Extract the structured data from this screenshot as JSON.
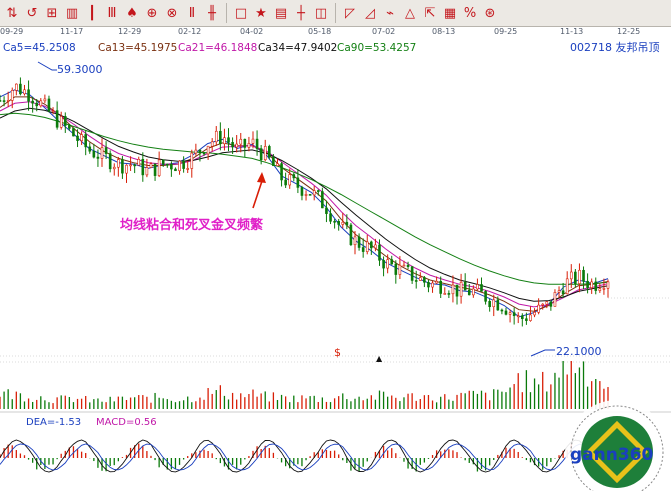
{
  "toolbar": {
    "icons": [
      "quote-icon",
      "reload-icon",
      "chart-icon",
      "grid-icon",
      "candle-icon",
      "bar-icon",
      "crosshair-icon",
      "target-icon",
      "zoom-icon",
      "line-icon",
      "bar-up-icon",
      "box-icon",
      "fan-icon",
      "draw-icon",
      "book-icon",
      "scale-icon",
      "fan-lines-icon",
      "curve-icon",
      "wave-icon",
      "triangle-icon",
      "pitch-icon",
      "channel-icon",
      "percent-icon",
      "gann-icon"
    ],
    "labels": [
      "⇅",
      "↺",
      "⊞",
      "▥",
      "┃",
      "Ⅲ",
      "♠",
      "⊕",
      "⊗",
      "Ⅱ",
      "╫",
      "□",
      "★",
      "▤",
      "┼",
      "◫",
      "◸",
      "◿",
      "⌁",
      "△",
      "⇱",
      "▦",
      "%",
      "⊛"
    ]
  },
  "dates": [
    "09-29",
    "11-17",
    "12-29",
    "02-12",
    "04-02",
    "05-18",
    "07-02",
    "08-13",
    "09-25",
    "11-13",
    "12-25"
  ],
  "header": {
    "ma_labels": [
      "Ca5=45.2508",
      "Ca13=45.1975",
      "Ca21=46.1848",
      "Ca34=47.9402",
      "Ca90=53.4257"
    ],
    "ma_colors": [
      "#1a3fbf",
      "#7a3010",
      "#c018a8",
      "#111111",
      "#148014"
    ],
    "stock": "002718  友邦吊顶"
  },
  "annotations": {
    "high_label": "59.3000",
    "low_label": "22.1000",
    "text": "均线粘合和死叉金叉频繁",
    "dollar": "$",
    "arrow_up": "▲"
  },
  "macd_panel": {
    "dea_label": "DEA=-1.53",
    "macd_label": "MACD=0.56"
  },
  "logo": {
    "text": "gann360"
  },
  "colors": {
    "up": "#d81e06",
    "down": "#0a7a0a",
    "ma5": "#1a3fbf",
    "ma13": "#7a3010",
    "ma21": "#c018a8",
    "ma34": "#111111",
    "ma90": "#148014",
    "annotation": "#e020c8",
    "arrow": "#d81e06"
  },
  "chart_data": {
    "type": "candlestick",
    "ylim": [
      20,
      62
    ],
    "price": {
      "x_index": [
        0,
        15,
        30,
        45,
        60,
        75,
        90,
        105,
        120,
        135,
        150,
        165,
        180,
        195,
        210,
        225,
        240,
        255,
        270,
        285,
        300,
        315,
        330,
        345,
        360,
        375,
        390,
        405,
        420,
        435,
        450,
        465,
        480,
        495,
        510,
        525,
        540,
        555,
        570,
        585,
        600,
        615
      ],
      "close": [
        56,
        58,
        57,
        55,
        53,
        51,
        49,
        48,
        47,
        47,
        46,
        47,
        47,
        48,
        50,
        51,
        49,
        50,
        48,
        45,
        44,
        43,
        41,
        38,
        36,
        35,
        33,
        32,
        31,
        30,
        30,
        29,
        29,
        28,
        27,
        25,
        26,
        27,
        30,
        31,
        30,
        31
      ]
    },
    "moving_averages": [
      {
        "name": "Ca5",
        "values": [
          56.5,
          57.5,
          56.8,
          55,
          53,
          51.2,
          49.2,
          48.2,
          47.2,
          47,
          46.4,
          46.9,
          47.2,
          48.3,
          49.9,
          50.5,
          49.2,
          49.8,
          48.2,
          45.3,
          44.2,
          43,
          40.9,
          38.1,
          36.1,
          34.8,
          33.1,
          32,
          31,
          30.1,
          29.9,
          29.1,
          28.9,
          28,
          27,
          25.4,
          26,
          27.2,
          29.6,
          30.6,
          30.1,
          30.8
        ]
      },
      {
        "name": "Ca13",
        "values": [
          55,
          56.5,
          56.5,
          55.5,
          54,
          52,
          50.2,
          48.8,
          47.8,
          47.2,
          46.8,
          46.8,
          47,
          47.8,
          49.2,
          50,
          49.6,
          49.6,
          48.6,
          46.5,
          45,
          43.5,
          41.8,
          39.2,
          37,
          35.6,
          34,
          32.6,
          31.5,
          30.6,
          30.1,
          29.6,
          29.2,
          28.5,
          27.6,
          26.4,
          26.2,
          27,
          28.6,
          29.8,
          30,
          30.4
        ]
      },
      {
        "name": "Ca21",
        "values": [
          54.5,
          55.6,
          55.8,
          55.2,
          54,
          52.6,
          51,
          49.6,
          48.5,
          47.8,
          47.2,
          47,
          47,
          47.5,
          48.5,
          49.4,
          49.5,
          49.6,
          48.8,
          47.3,
          45.8,
          44.3,
          42.6,
          40.3,
          38.3,
          36.7,
          35,
          33.5,
          32.3,
          31.3,
          30.6,
          30,
          29.6,
          29,
          28.2,
          27.2,
          26.8,
          27.1,
          28.1,
          29.2,
          29.6,
          30.1
        ]
      },
      {
        "name": "Ca34",
        "values": [
          53.5,
          54.5,
          54.9,
          54.6,
          54,
          53,
          51.8,
          50.6,
          49.5,
          48.7,
          48,
          47.6,
          47.4,
          47.5,
          48,
          48.6,
          48.8,
          49,
          48.5,
          47.5,
          46.3,
          45,
          43.5,
          41.6,
          39.8,
          38.1,
          36.4,
          34.9,
          33.5,
          32.3,
          31.4,
          30.6,
          30.1,
          29.5,
          28.8,
          28,
          27.6,
          27.7,
          28.2,
          29,
          29.4,
          29.8
        ]
      },
      {
        "name": "Ca90",
        "values": [
          54,
          54.2,
          54,
          53.6,
          53,
          52.3,
          51.6,
          50.9,
          50.3,
          49.8,
          49.4,
          49.1,
          48.9,
          48.7,
          48.6,
          48.4,
          48.1,
          47.8,
          47.2,
          46.5,
          45.7,
          44.8,
          43.8,
          42.7,
          41.5,
          40.3,
          39.1,
          37.9,
          36.7,
          35.6,
          34.6,
          33.6,
          32.7,
          31.9,
          31.2,
          30.6,
          30.2,
          30,
          30,
          30,
          30.1,
          30.3
        ]
      }
    ],
    "volume": [
      20,
      18,
      16,
      14,
      12,
      13,
      11,
      10,
      12,
      14,
      13,
      15,
      12,
      14,
      20,
      22,
      16,
      18,
      15,
      14,
      13,
      14,
      12,
      16,
      14,
      15,
      17,
      14,
      16,
      15,
      14,
      16,
      18,
      17,
      20,
      38,
      30,
      35,
      55,
      60,
      42,
      28
    ],
    "macd": {
      "dea": -1.53,
      "macd": 0.56
    }
  }
}
